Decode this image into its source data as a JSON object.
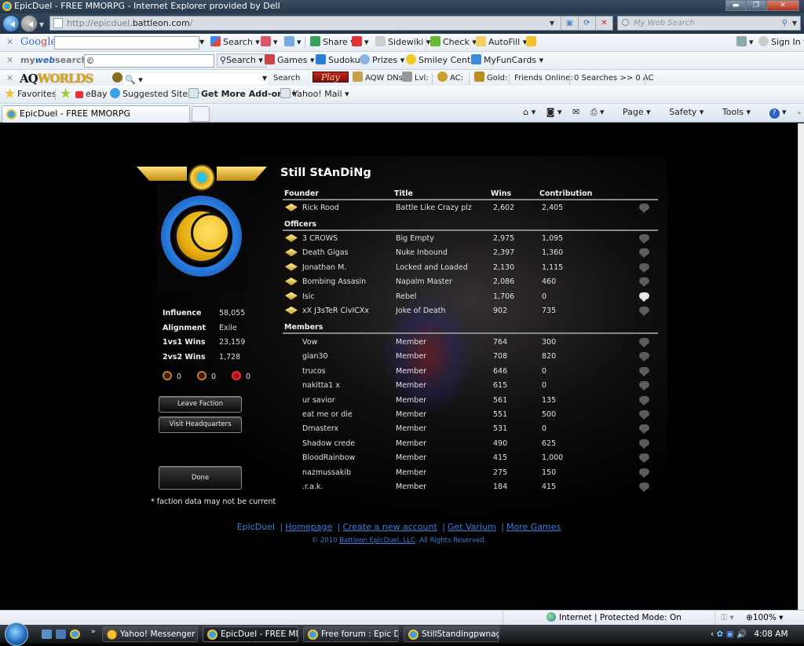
{
  "window": {
    "title": "EpicDuel - FREE MMORPG - Internet Explorer provided by Dell",
    "controls": [
      "minimize",
      "restore",
      "close"
    ]
  },
  "address_bar": {
    "url_prefix": "http://epicduel.",
    "url_host": "battleon.com",
    "url_suffix": "/",
    "search_placeholder": "My Web Search"
  },
  "toolbars": {
    "google": {
      "brand_1": "Goo",
      "brand_2": "g",
      "brand_3": "le",
      "search_label": "Search",
      "share_label": "Share",
      "sidewiki_label": "Sidewiki",
      "check_label": "Check",
      "autofill_label": "AutoFill",
      "signin_label": "Sign In"
    },
    "mywebsearch": {
      "brand_1": "my",
      "brand_2": "web",
      "brand_3": "search",
      "input_value": "©",
      "search_label": "Search",
      "games_label": "Games",
      "sudoku_label": "Sudoku",
      "prizes_label": "Prizes",
      "smiley_label": "Smiley Central",
      "myfuncards_label": "MyFunCards"
    },
    "aqworlds": {
      "brand_1": "AQ",
      "brand_2": "WORLDS",
      "search_label": "Search",
      "play_label": "Play",
      "dns_label": "AQW DNs!",
      "lvl_label": "Lvl:",
      "ac_label": "AC:",
      "gold_label": "Gold:",
      "friends_label": "Friends Online:",
      "searches_label": "0 Searches >> 0 AC"
    },
    "favorites": {
      "favorites_label": "Favorites",
      "ebay_label": "eBay",
      "suggested_label": "Suggested Sites",
      "addons_label": "Get More Add-ons",
      "yahoo_label": "Yahoo! Mail"
    }
  },
  "tabs": {
    "active_tab": "EpicDuel - FREE MMORPG",
    "commands": {
      "page": "Page",
      "safety": "Safety",
      "tools": "Tools"
    }
  },
  "faction": {
    "name": "Still StAnDiNg",
    "stats": [
      {
        "label": "Influence",
        "value": "58,055"
      },
      {
        "label": "Alignment",
        "value": "Exile"
      },
      {
        "label": "1vs1 Wins",
        "value": "23,159"
      },
      {
        "label": "2vs2 Wins",
        "value": "1,728"
      }
    ],
    "currencies": [
      "0",
      "0",
      "0"
    ],
    "buttons": {
      "leave": "Leave Faction",
      "visit": "Visit Headquarters",
      "done": "Done"
    },
    "note": "* faction data may not be current",
    "columns": {
      "founder": "Founder",
      "title": "Title",
      "wins": "Wins",
      "contribution": "Contribution"
    },
    "officers_header": "Officers",
    "members_header": "Members",
    "founder": {
      "name": "Rick Rood",
      "title": "Battle Like Crazy plz",
      "wins": "2,602",
      "contribution": "2,405",
      "online": false
    },
    "officers": [
      {
        "name": "3 CROWS",
        "title": "Big Empty",
        "wins": "2,975",
        "contribution": "1,095",
        "online": false
      },
      {
        "name": "Death Gigas",
        "title": "Nuke Inbound",
        "wins": "2,397",
        "contribution": "1,360",
        "online": false
      },
      {
        "name": "Jonathan M.",
        "title": "Locked and Loaded",
        "wins": "2,130",
        "contribution": "1,115",
        "online": false
      },
      {
        "name": "Bombing Assasin",
        "title": "Napalm Master",
        "wins": "2,086",
        "contribution": "460",
        "online": false
      },
      {
        "name": "Isic",
        "title": "Rebel",
        "wins": "1,706",
        "contribution": "0",
        "online": true
      },
      {
        "name": "xX J3sTeR CivICXx",
        "title": "Joke of Death",
        "wins": "902",
        "contribution": "735",
        "online": false
      }
    ],
    "members": [
      {
        "name": "Vow",
        "title": "Member",
        "wins": "764",
        "contribution": "300"
      },
      {
        "name": "gian30",
        "title": "Member",
        "wins": "708",
        "contribution": "820"
      },
      {
        "name": "trucos",
        "title": "Member",
        "wins": "646",
        "contribution": "0"
      },
      {
        "name": "nakitta1 x",
        "title": "Member",
        "wins": "615",
        "contribution": "0"
      },
      {
        "name": "ur savior",
        "title": "Member",
        "wins": "561",
        "contribution": "135"
      },
      {
        "name": "eat me or die",
        "title": "Member",
        "wins": "551",
        "contribution": "500"
      },
      {
        "name": "Dmasterx",
        "title": "Member",
        "wins": "531",
        "contribution": "0"
      },
      {
        "name": "Shadow crede",
        "title": "Member",
        "wins": "490",
        "contribution": "625"
      },
      {
        "name": "BloodRainbow",
        "title": "Member",
        "wins": "415",
        "contribution": "1,000"
      },
      {
        "name": "nazmussakib",
        "title": "Member",
        "wins": "275",
        "contribution": "150"
      },
      {
        "name": ".r.a.k.",
        "title": "Member",
        "wins": "184",
        "contribution": "415"
      }
    ]
  },
  "footer": {
    "brand": "EpicDuel",
    "links": [
      "Homepage",
      "Create a new account",
      "Get Varium",
      "More Games"
    ],
    "copyright_prefix": "© 2010 ",
    "copyright_link": "Battleon EpicDuel, LLC",
    "copyright_suffix": ". All Rights Reserved."
  },
  "status_bar": {
    "zone": "Internet | Protected Mode: On",
    "zoom": "100%"
  },
  "taskbar": {
    "items": [
      {
        "label": "Yahoo! Messenger",
        "active": false
      },
      {
        "label": "EpicDuel - FREE MM...",
        "active": true
      },
      {
        "label": "Free forum : Epic Du...",
        "active": false
      },
      {
        "label": "StillStandingpwnag...",
        "active": false
      }
    ],
    "clock": "4:08 AM"
  }
}
